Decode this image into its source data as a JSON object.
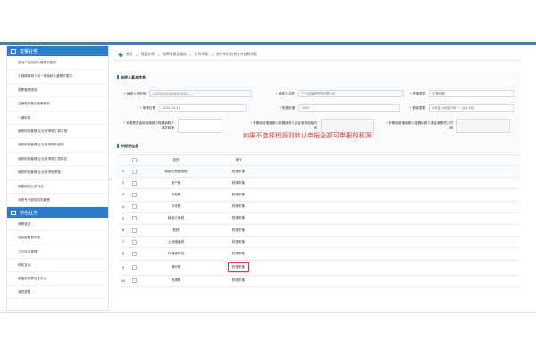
{
  "sidebar": {
    "section1_title": "套餐业务",
    "section1_items": [
      "房地产税纳税人套餐式服务",
      "小规模纳税人转一般纳税人套餐式服务",
      "发票套餐服务",
      "注销税务登记套餐服务",
      "一键申报",
      "新税申报套餐-企业所得税汇算月报",
      "新税申报套餐-企业所得税年度报",
      "新税申报套餐-企业所得税汇算报告",
      "新税申报套餐-企业所得税季报",
      "房屋租赁三方协议",
      "涉税专业服务机构套餐"
    ],
    "section2_title": "特色业务",
    "section2_items": [
      "政策速递",
      "社会保险费申报",
      "三方协议管理",
      "税收互动",
      "增值税发票认证平台",
      "我的提醒"
    ],
    "collapse_arrow": "«"
  },
  "breadcrumb": [
    "首页",
    "我要办税",
    "税费申报及缴纳",
    "综合申报",
    "财产和行为税合并纳税申报"
  ],
  "basic_info": {
    "title": "纳税人基本信息",
    "taxpayer_id_label": "纳税人识别号",
    "taxpayer_id_value": "91440101MA5AXXXXX",
    "taxpayer_name_label": "纳税人名称",
    "taxpayer_name_value": "广州市某某贸易有限公司",
    "declare_type_label": "申报类型",
    "declare_type_value": "正常申报",
    "declare_date_label": "申报日期",
    "declare_date_value": "2021-05-11",
    "tax_year_label": "所属年度",
    "tax_year_value": "2021",
    "tax_period_label": "税款属期",
    "tax_period_value": "4月至 (4月至5月) ~ (从4-5月)",
    "q1_label": "本期是否适用增值税小规模纳税人减征政策",
    "q2_label": "本期适用增值税小规模纳税人减征政策起始时间",
    "q3_label": "本期适用增值税小规模纳税人减征政策终止时间"
  },
  "warning": "如果不选择税源则默认申报全部可申报的税源！",
  "table": {
    "title": "申报表信息",
    "headers": {
      "no": "序号",
      "name": "税种",
      "op": "操作"
    },
    "rows": [
      {
        "no": "1",
        "name": "城镇土地使用税",
        "op": "税源采集"
      },
      {
        "no": "2",
        "name": "房产税",
        "op": "税源采集"
      },
      {
        "no": "3",
        "name": "车船税",
        "op": "税源采集"
      },
      {
        "no": "4",
        "name": "印花税",
        "op": "税源采集"
      },
      {
        "no": "5",
        "name": "耕地占用税",
        "op": "税源采集"
      },
      {
        "no": "6",
        "name": "契税",
        "op": "税源采集"
      },
      {
        "no": "7",
        "name": "土地增值税",
        "op": "税源采集"
      },
      {
        "no": "8",
        "name": "环境保护税",
        "op": "税源采集"
      },
      {
        "no": "9",
        "name": "烟叶税",
        "op": "税源采集"
      },
      {
        "no": "10",
        "name": "资源税",
        "op": "税源采集"
      }
    ]
  },
  "colors": {
    "accent": "#2f7bc7",
    "warning": "#e53935"
  }
}
